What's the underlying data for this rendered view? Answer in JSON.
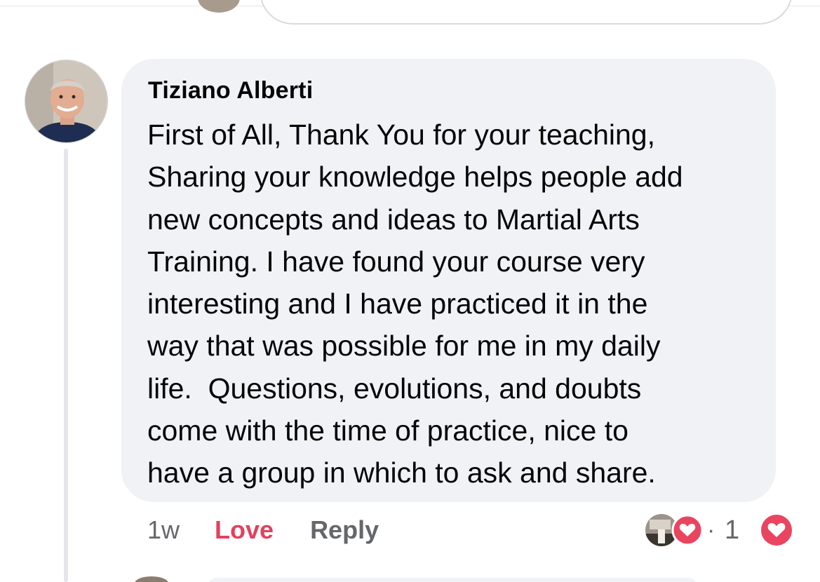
{
  "comment": {
    "author": "Tiziano Alberti",
    "text_lines": [
      "First of All, Thank You for your teaching,",
      "Sharing your knowledge helps people add",
      "new concepts and ideas to Martial Arts",
      "Training. I have found your course very",
      "interesting and I have practiced it in the",
      "way that was possible for me in my daily",
      "life.  Questions, evolutions, and doubts",
      "come with the time of practice, nice to",
      "have a group in which to ask and share."
    ],
    "timestamp": "1w",
    "love_label": "Love",
    "reply_label": "Reply"
  },
  "reactions": {
    "separator": "·",
    "count": "1",
    "reactor_icon": "heart-icon",
    "reaction_icon": "love-reaction-icon"
  },
  "colors": {
    "bubble_background": "#f0f2f5",
    "love_accent": "#e4405f",
    "secondary_text": "#65676b",
    "primary_text": "#050505"
  }
}
